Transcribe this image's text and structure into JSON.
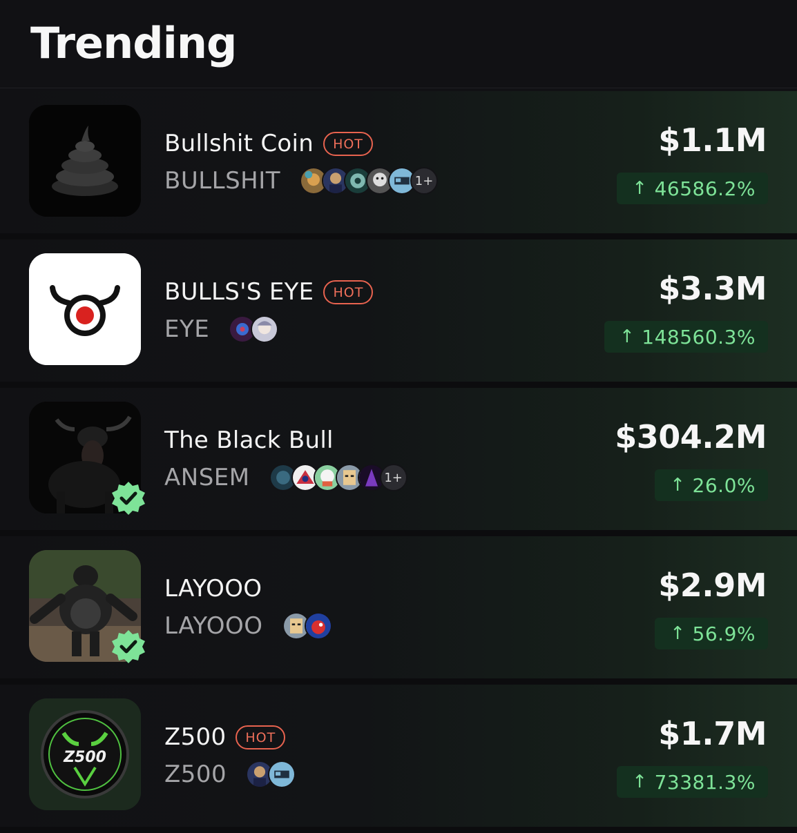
{
  "header": {
    "title": "Trending"
  },
  "tokens": [
    {
      "name": "Bullshit Coin",
      "hot": "HOT",
      "ticker": "BULLSHIT",
      "holders_more": "1+",
      "market_cap": "$1.1M",
      "change": "46586.2%",
      "logo_icon": "poop-icon",
      "verified": false
    },
    {
      "name": "BULLS'S EYE",
      "hot": "HOT",
      "ticker": "EYE",
      "holders_more": "",
      "market_cap": "$3.3M",
      "change": "148560.3%",
      "logo_icon": "bulls-eye-icon",
      "verified": false
    },
    {
      "name": "The Black Bull",
      "hot": "",
      "ticker": "ANSEM",
      "holders_more": "1+",
      "market_cap": "$304.2M",
      "change": "26.0%",
      "logo_icon": "black-bull-icon",
      "verified": true
    },
    {
      "name": "LAYOOO",
      "hot": "",
      "ticker": "LAYOOO",
      "holders_more": "",
      "market_cap": "$2.9M",
      "change": "56.9%",
      "logo_icon": "gorilla-icon",
      "verified": true
    },
    {
      "name": "Z500",
      "hot": "HOT",
      "ticker": "Z500",
      "holders_more": "",
      "market_cap": "$1.7M",
      "change": "73381.3%",
      "logo_icon": "z500-logo-icon",
      "logo_text": "Z500",
      "verified": false
    }
  ],
  "colors": {
    "hot": "#ef6f5a",
    "positive": "#7ee398",
    "positive_bg": "#14301f",
    "verified": "#7ee398"
  },
  "arrow_glyph": "↑"
}
